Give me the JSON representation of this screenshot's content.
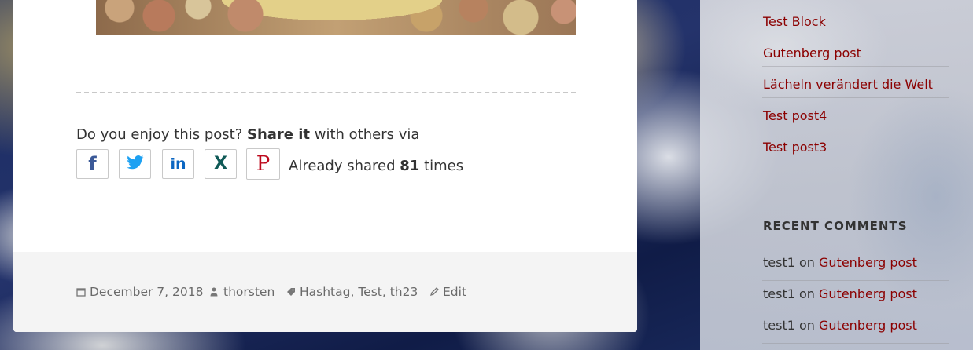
{
  "share": {
    "prompt_pre": "Do you enjoy this post? ",
    "prompt_bold": "Share it",
    "prompt_post": " with others via",
    "buttons": [
      {
        "name": "facebook",
        "glyph": "f",
        "color": "#3b5998"
      },
      {
        "name": "twitter",
        "color": "#1da1f2"
      },
      {
        "name": "linkedin",
        "glyph": "in",
        "color": "#0a66c2"
      },
      {
        "name": "x",
        "glyph": "X",
        "color": "#0f5a57"
      },
      {
        "name": "pinterest",
        "glyph": "P",
        "color": "#bd081c"
      }
    ],
    "count_pre": "Already shared ",
    "count": "81",
    "count_post": " times"
  },
  "meta": {
    "date": "December 7, 2018",
    "author": "thorsten",
    "tags": "Hashtag, Test, th23",
    "edit": "Edit"
  },
  "sidebar": {
    "recent_posts": [
      "Test Block",
      "Gutenberg post",
      "Lächeln verändert die Welt",
      "Test post4",
      "Test post3"
    ],
    "recent_comments_title": "RECENT COMMENTS",
    "recent_comments": [
      {
        "author": "test1",
        "on": " on ",
        "post": "Gutenberg post"
      },
      {
        "author": "test1",
        "on": " on ",
        "post": "Gutenberg post"
      },
      {
        "author": "test1",
        "on": " on ",
        "post": "Gutenberg post"
      }
    ]
  },
  "colors": {
    "link": "#8b0000",
    "footer_bg": "#f4f4f4"
  }
}
